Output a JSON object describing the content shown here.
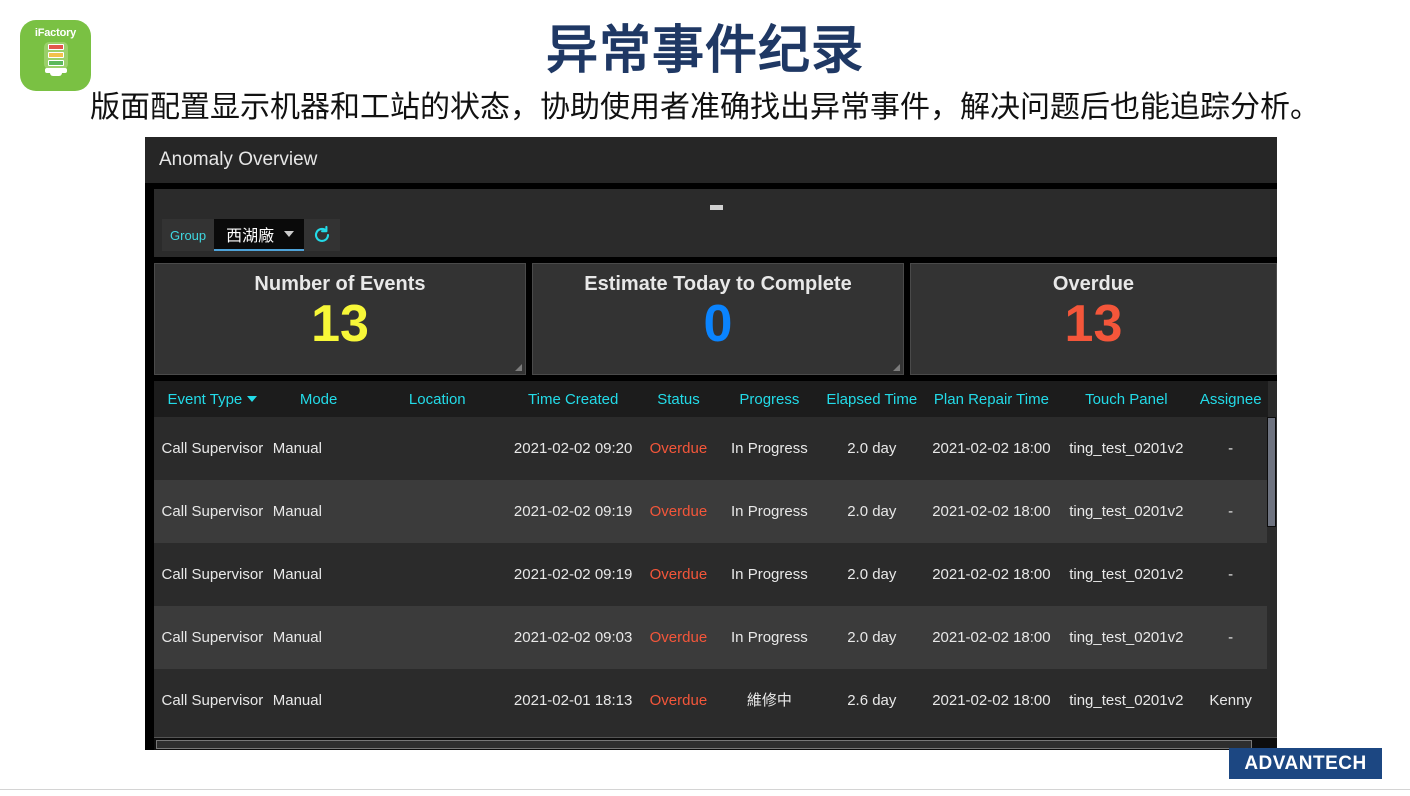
{
  "brand": {
    "logo_label": "iFactory",
    "logo_icon": "signal-tower-icon",
    "logo_bg": "#7ac143",
    "footer_logo": "ADVANTECH",
    "footer_logo_bg": "#1c4782"
  },
  "slide": {
    "title": "异常事件纪录",
    "title_color": "#1f3864",
    "subtitle": "版面配置显示机器和工站的状态，协助使用者准确找出异常事件，解决问题后也能追踪分析。"
  },
  "dashboard": {
    "window_title": "Anomaly Overview",
    "collapse_indicator": "-",
    "filter": {
      "group_label": "Group",
      "group_value": "西湖廠",
      "dropdown_icon": "chevron-down-icon",
      "refresh_icon": "refresh-icon",
      "refresh_glyph": "↺",
      "accent_color": "#3fd7e0"
    },
    "kpis": [
      {
        "title": "Number of Events",
        "value": "13",
        "color": "#f7f738"
      },
      {
        "title": "Estimate Today to Complete",
        "value": "0",
        "color": "#0a84ff"
      },
      {
        "title": "Overdue",
        "value": "13",
        "color": "#f4563a"
      }
    ],
    "table": {
      "header_color": "#23dbe8",
      "sort_column": "Event Type",
      "sort_icon": "sort-descending-caret",
      "columns": [
        "Event Type",
        "Mode",
        "Location",
        "Time Created",
        "Status",
        "Progress",
        "Elapsed Time",
        "Plan Repair Time",
        "Touch Panel",
        "Assignee"
      ],
      "rows": [
        {
          "event_type": "Call Supervisor",
          "mode": "Manual",
          "location": "",
          "time_created": "2021-02-02 09:20",
          "status": "Overdue",
          "progress": "In Progress",
          "elapsed_time": "2.0 day",
          "plan_repair_time": "2021-02-02 18:00",
          "touch_panel": "ting_test_0201v2",
          "assignee": "-"
        },
        {
          "event_type": "Call Supervisor",
          "mode": "Manual",
          "location": "",
          "time_created": "2021-02-02 09:19",
          "status": "Overdue",
          "progress": "In Progress",
          "elapsed_time": "2.0 day",
          "plan_repair_time": "2021-02-02 18:00",
          "touch_panel": "ting_test_0201v2",
          "assignee": "-"
        },
        {
          "event_type": "Call Supervisor",
          "mode": "Manual",
          "location": "",
          "time_created": "2021-02-02 09:19",
          "status": "Overdue",
          "progress": "In Progress",
          "elapsed_time": "2.0 day",
          "plan_repair_time": "2021-02-02 18:00",
          "touch_panel": "ting_test_0201v2",
          "assignee": "-"
        },
        {
          "event_type": "Call Supervisor",
          "mode": "Manual",
          "location": "",
          "time_created": "2021-02-02 09:03",
          "status": "Overdue",
          "progress": "In Progress",
          "elapsed_time": "2.0 day",
          "plan_repair_time": "2021-02-02 18:00",
          "touch_panel": "ting_test_0201v2",
          "assignee": "-"
        },
        {
          "event_type": "Call Supervisor",
          "mode": "Manual",
          "location": "",
          "time_created": "2021-02-01 18:13",
          "status": "Overdue",
          "progress": "維修中",
          "elapsed_time": "2.6 day",
          "plan_repair_time": "2021-02-02 18:00",
          "touch_panel": "ting_test_0201v2",
          "assignee": "Kenny"
        }
      ]
    }
  }
}
